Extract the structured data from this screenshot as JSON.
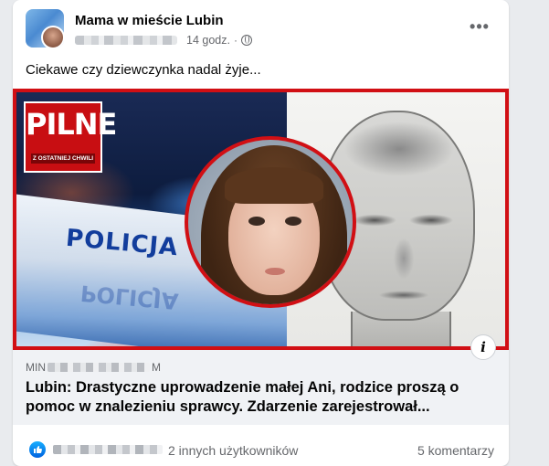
{
  "post": {
    "page_name": "Mama w mieście Lubin",
    "time": "14 godz.",
    "meta_separator": "·",
    "text": "Ciekawe czy dziewczynka nadal żyje...",
    "more_label": "•••"
  },
  "image": {
    "badge_title": "PILNE",
    "badge_subtitle": "Z OSTATNIEJ CHWILI",
    "car_text": "POLICJA",
    "info_label": "i",
    "frame_color": "#d10f14"
  },
  "link": {
    "domain_prefix": "MIN",
    "domain_suffix": "M",
    "title": "Lubin: Drastyczne uprowadzenie małej Ani, rodzice proszą o pomoc w znalezieniu sprawcy. Zdarzenie zarejestrował..."
  },
  "reactions": {
    "others_text": "2 innych użytkowników",
    "comments_text": "5 komentarzy",
    "like_color": "#0866ff"
  },
  "icons": [
    "avatar",
    "globe-icon",
    "more-icon",
    "info-icon",
    "like-icon"
  ]
}
